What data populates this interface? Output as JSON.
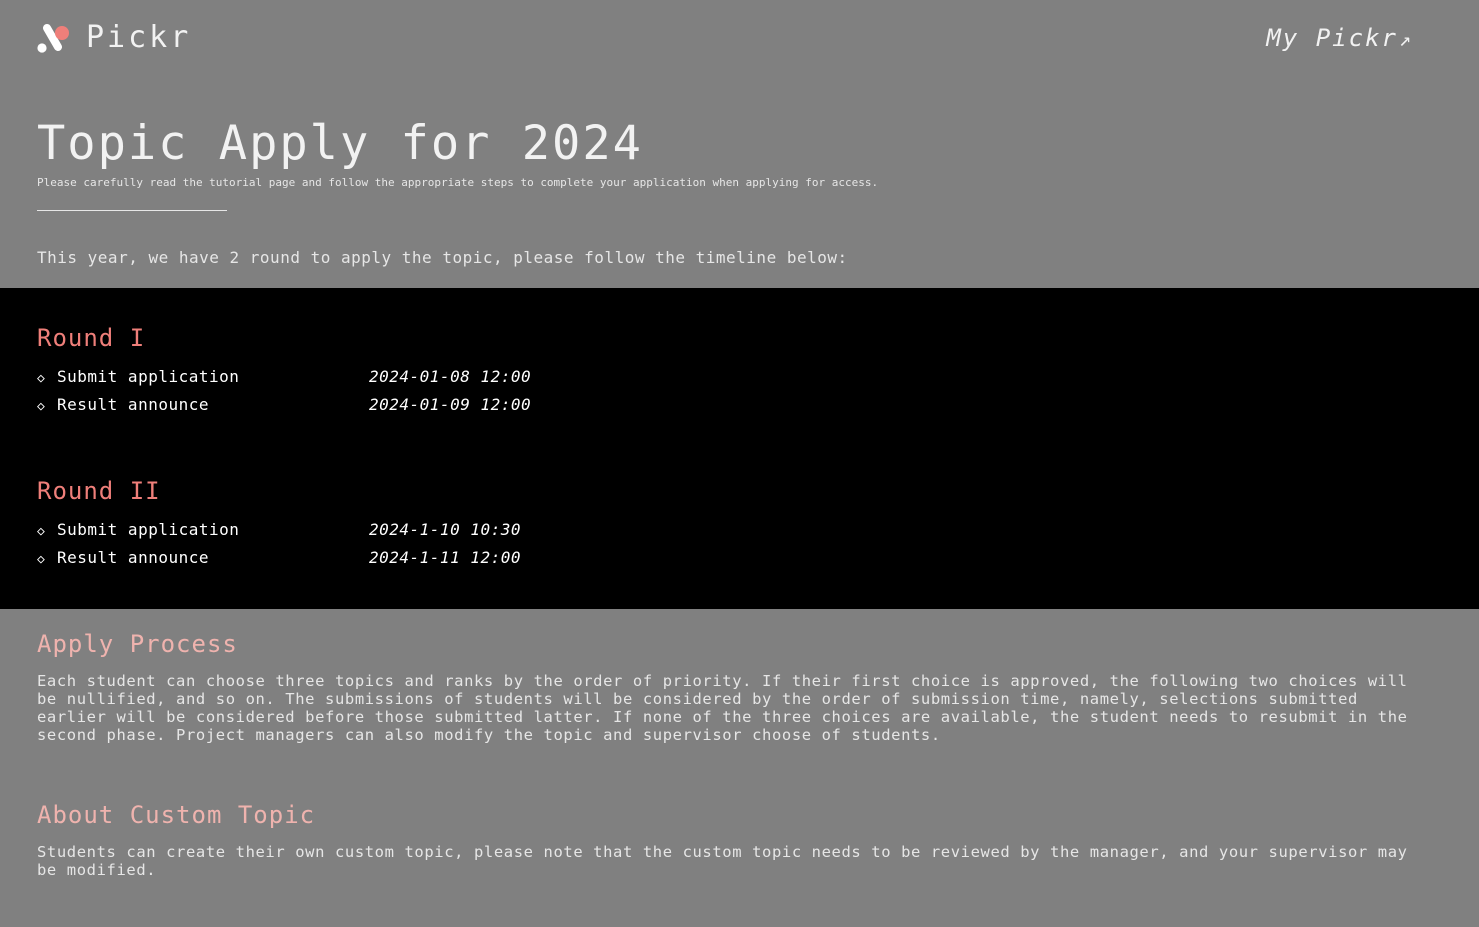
{
  "header": {
    "brand": "Pickr",
    "my_link_label": "My Pickr",
    "link_icon": "arrow-up-right-icon"
  },
  "hero": {
    "title": "Topic Apply for 2024",
    "subtitle": "Please carefully read the tutorial page and follow the appropriate steps to complete your application when applying for access.",
    "intro": "This year, we have 2 round to apply the topic, please follow the timeline below:"
  },
  "timeline": {
    "rounds": [
      {
        "title": "Round I",
        "steps": [
          {
            "label": "Submit application",
            "time": "2024-01-08 12:00"
          },
          {
            "label": "Result announce",
            "time": "2024-01-09 12:00"
          }
        ]
      },
      {
        "title": "Round II",
        "steps": [
          {
            "label": "Submit application",
            "time": "2024-1-10 10:30"
          },
          {
            "label": "Result announce",
            "time": "2024-1-11 12:00"
          }
        ]
      }
    ]
  },
  "apply_process": {
    "title": "Apply Process",
    "body": "Each student can choose three topics and ranks by the order of priority. If their first choice is approved, the following two choices will be nullified, and so on. The submissions of students will be considered by the order of submission time, namely, selections submitted earlier will be considered before those submitted latter. If none of the three choices are available, the student needs to resubmit in the second phase. Project managers can also modify the topic and supervisor choose of students."
  },
  "custom_topic": {
    "title": "About Custom Topic",
    "body": "Students can create their own custom topic, please note that the custom topic needs to be reviewed by the manager, and your supervisor may be modified."
  },
  "colors": {
    "page_bg": "#808080",
    "timeline_bg": "#000000",
    "round_title": "#ef7f7a",
    "section_title": "#efb3ae",
    "text": "#e6e6e6"
  }
}
